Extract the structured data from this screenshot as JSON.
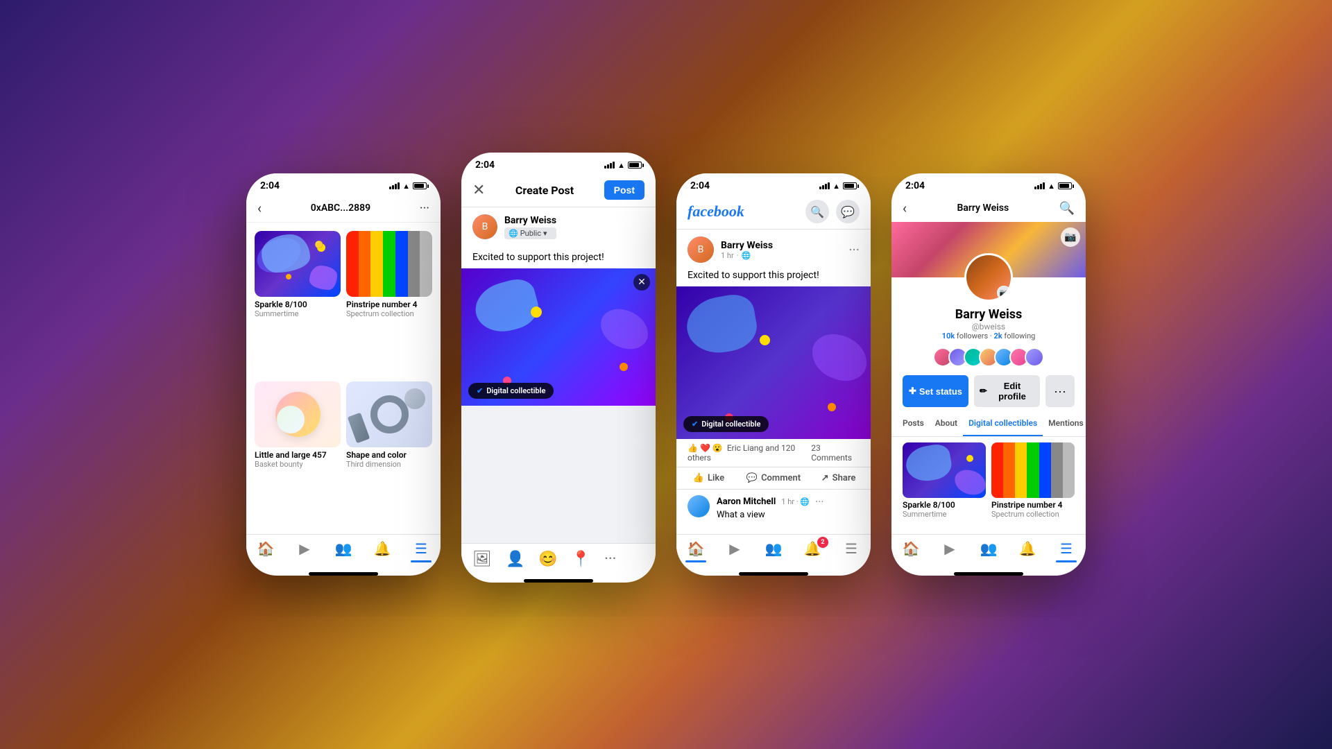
{
  "background": {
    "gradient": "linear-gradient(135deg, #2d1b6b, #6b2d8b, #8b4513, #d4a020, #c06030, #6b2d8b, #1a1a4e)"
  },
  "phone1": {
    "time": "2:04",
    "title": "0xABC...2889",
    "nfts": [
      {
        "title": "Sparkle 8/100",
        "subtitle": "Summertime",
        "type": "sparkle"
      },
      {
        "title": "Pinstripe number 4",
        "subtitle": "Spectrum collection",
        "type": "spectrum"
      },
      {
        "title": "Little and large 457",
        "subtitle": "Basket bounty",
        "type": "basket"
      },
      {
        "title": "Shape and color",
        "subtitle": "Third dimension",
        "type": "dimension"
      }
    ],
    "nav": [
      "home",
      "video",
      "groups",
      "bell",
      "menu"
    ]
  },
  "phone2": {
    "time": "2:04",
    "header": {
      "title": "Create Post",
      "post_btn": "Post"
    },
    "author": "Barry Weiss",
    "privacy": "Public",
    "post_text": "Excited to support this project!",
    "badge": "Digital collectible",
    "toolbar_icons": [
      "photo",
      "tag",
      "emoji",
      "location",
      "more"
    ]
  },
  "phone3": {
    "time": "2:04",
    "logo": "facebook",
    "post": {
      "author": "Barry Weiss",
      "time": "1 hr",
      "text": "Excited to support this project!",
      "badge": "Digital collectible",
      "reactions": "Eric Liang and 120 others",
      "comments_count": "23 Comments",
      "actions": [
        "Like",
        "Comment",
        "Share"
      ]
    },
    "comment": {
      "author": "Aaron Mitchell",
      "time": "1 hr",
      "text": "What a view"
    },
    "nav": [
      "home",
      "video",
      "groups",
      "bell",
      "menu"
    ]
  },
  "phone4": {
    "time": "2:04",
    "profile": {
      "name": "Barry Weiss",
      "handle": "@bweiss",
      "followers": "10k",
      "following": "2k",
      "followers_label": "followers",
      "following_label": "following"
    },
    "buttons": {
      "set_status": "Set status",
      "edit_profile": "Edit profile"
    },
    "tabs": [
      "Posts",
      "About",
      "Digital collectibles",
      "Mentions"
    ],
    "active_tab": "Digital collectibles",
    "nfts": [
      {
        "title": "Sparkle 8/100",
        "subtitle": "Summertime",
        "type": "sparkle"
      },
      {
        "title": "Pinstripe number 4",
        "subtitle": "Spectrum collection",
        "type": "spectrum"
      }
    ],
    "nav": [
      "home",
      "video",
      "groups",
      "bell",
      "menu"
    ]
  }
}
